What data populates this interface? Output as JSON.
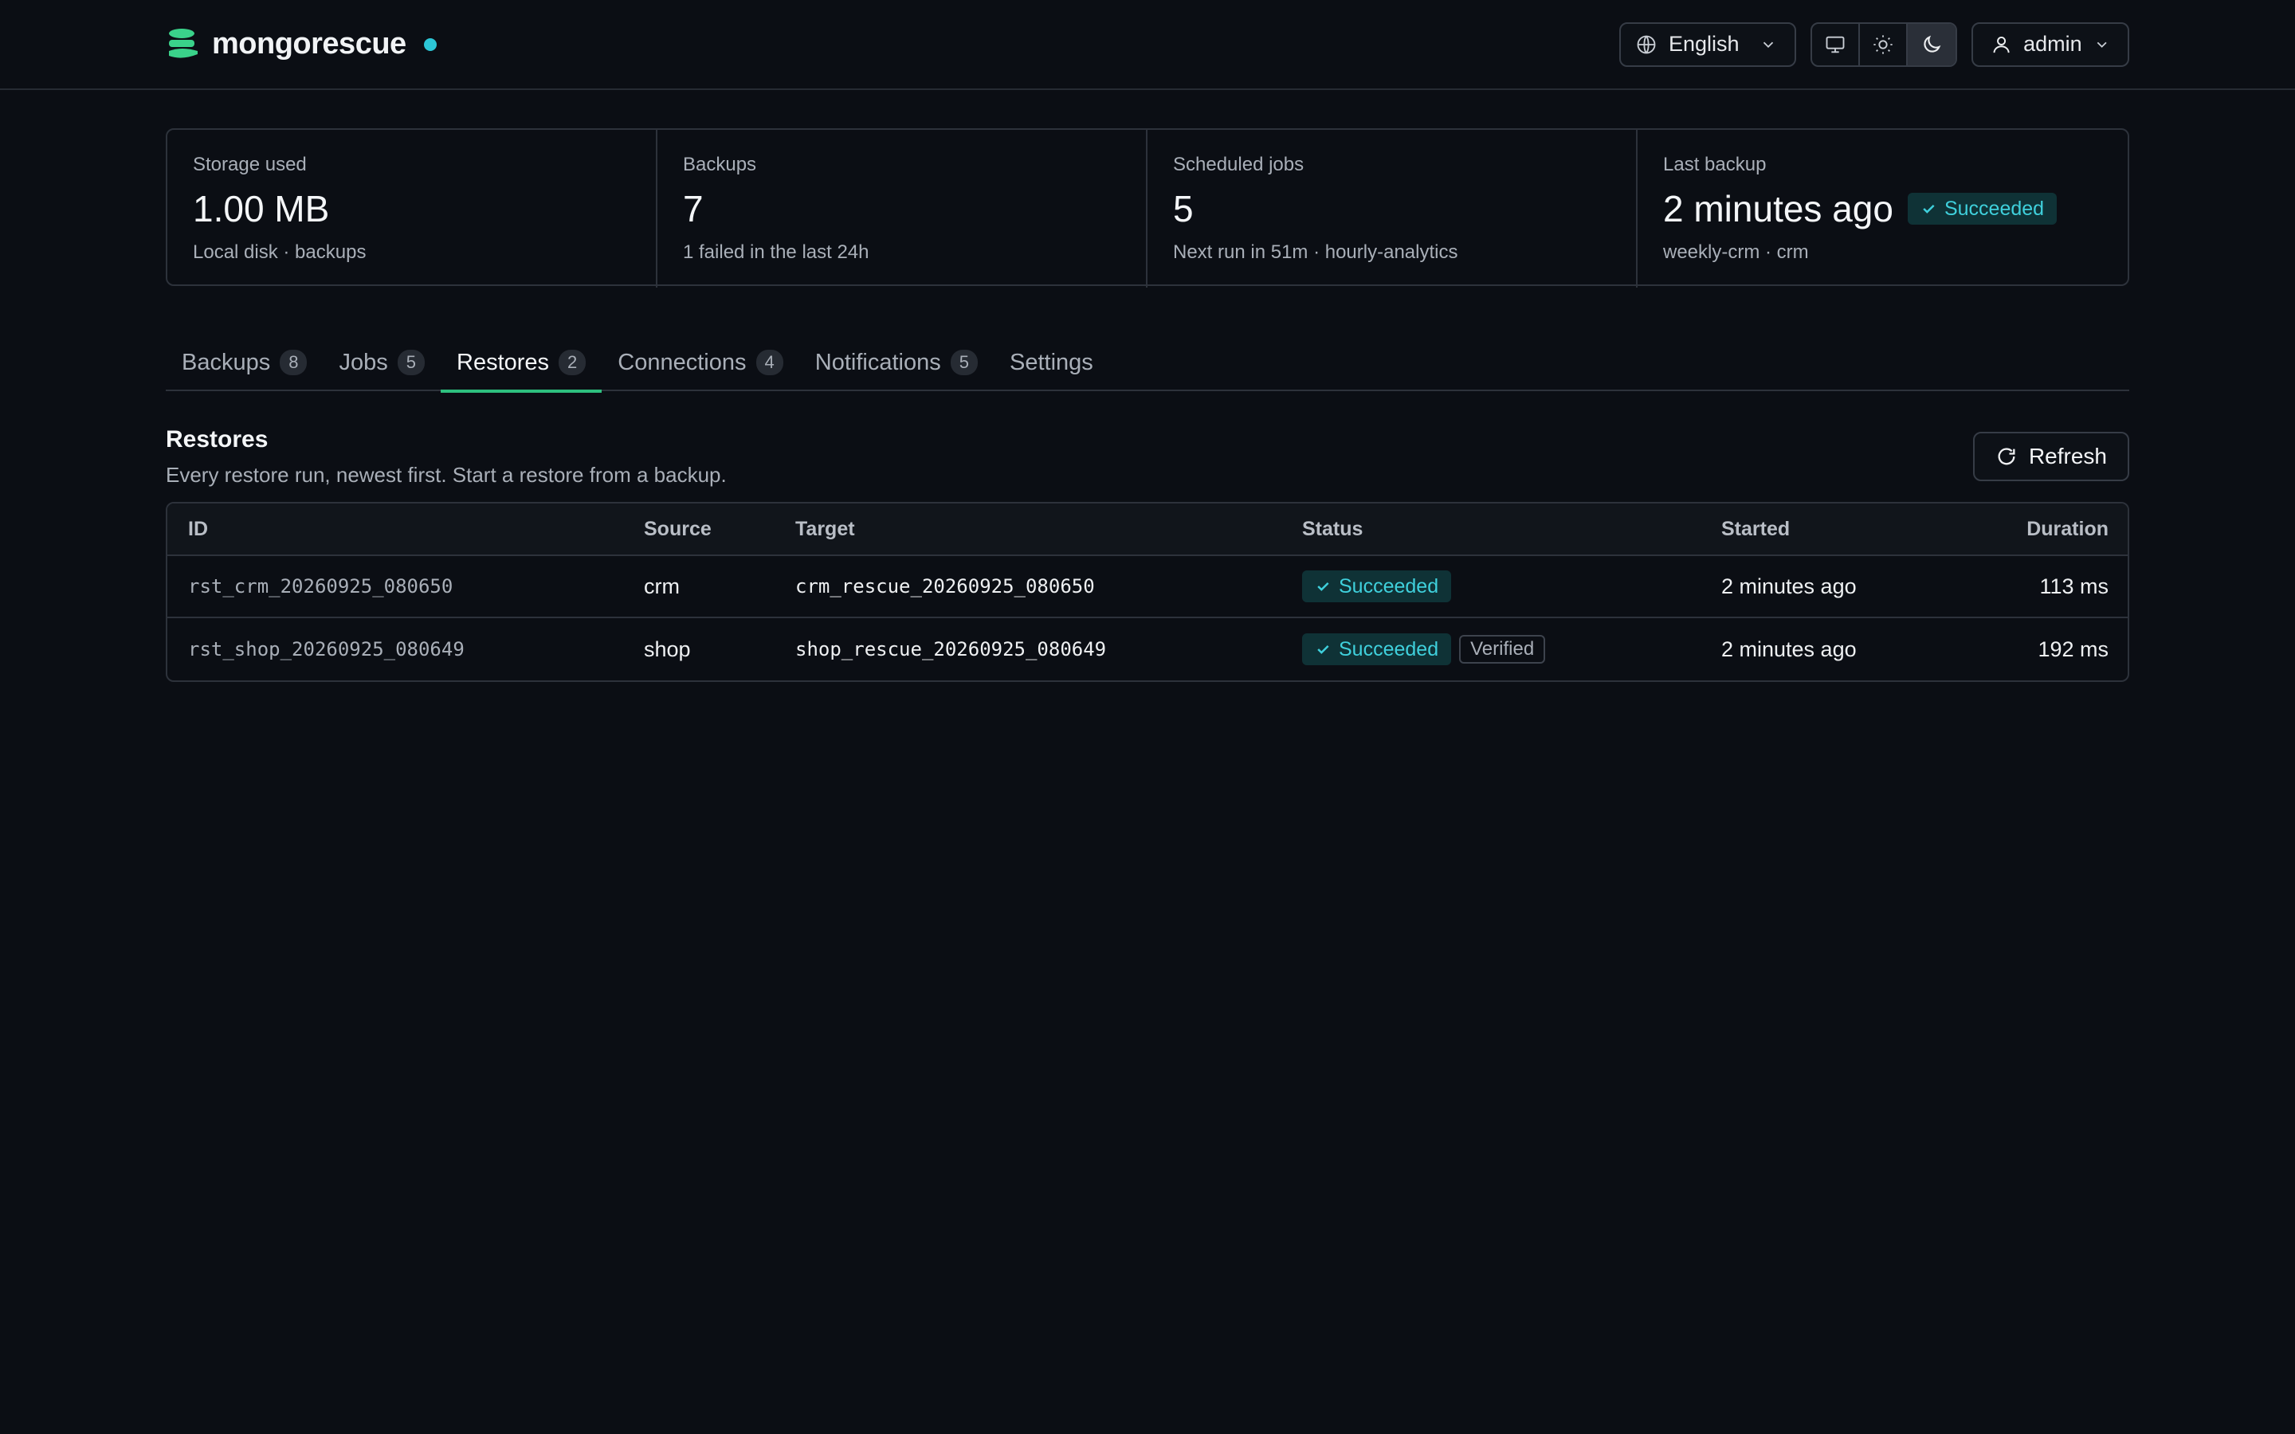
{
  "brand": {
    "name": "mongorescue"
  },
  "header": {
    "language": "English",
    "user": "admin"
  },
  "stats": [
    {
      "label": "Storage used",
      "value": "1.00 MB",
      "sub": "Local disk · backups"
    },
    {
      "label": "Backups",
      "value": "7",
      "sub": "1 failed in the last 24h"
    },
    {
      "label": "Scheduled jobs",
      "value": "5",
      "sub": "Next run in 51m · hourly-analytics"
    },
    {
      "label": "Last backup",
      "value": "2 minutes ago",
      "badge": "Succeeded",
      "sub": "weekly-crm · crm"
    }
  ],
  "tabs": [
    {
      "label": "Backups",
      "count": "8"
    },
    {
      "label": "Jobs",
      "count": "5"
    },
    {
      "label": "Restores",
      "count": "2"
    },
    {
      "label": "Connections",
      "count": "4"
    },
    {
      "label": "Notifications",
      "count": "5"
    },
    {
      "label": "Settings"
    }
  ],
  "section": {
    "title": "Restores",
    "description": "Every restore run, newest first. Start a restore from a backup.",
    "refresh_label": "Refresh"
  },
  "table": {
    "columns": [
      "ID",
      "Source",
      "Target",
      "Status",
      "Started",
      "Duration"
    ],
    "rows": [
      {
        "id": "rst_crm_20260925_080650",
        "source": "crm",
        "target": "crm_rescue_20260925_080650",
        "status": "Succeeded",
        "verified": "",
        "started": "2 minutes ago",
        "duration": "113 ms"
      },
      {
        "id": "rst_shop_20260925_080649",
        "source": "shop",
        "target": "shop_rescue_20260925_080649",
        "status": "Succeeded",
        "verified": "Verified",
        "started": "2 minutes ago",
        "duration": "192 ms"
      }
    ]
  },
  "colors": {
    "accent": "#2ebf7f",
    "status_ok": "#3fd0dc",
    "background": "#0b0e14"
  }
}
